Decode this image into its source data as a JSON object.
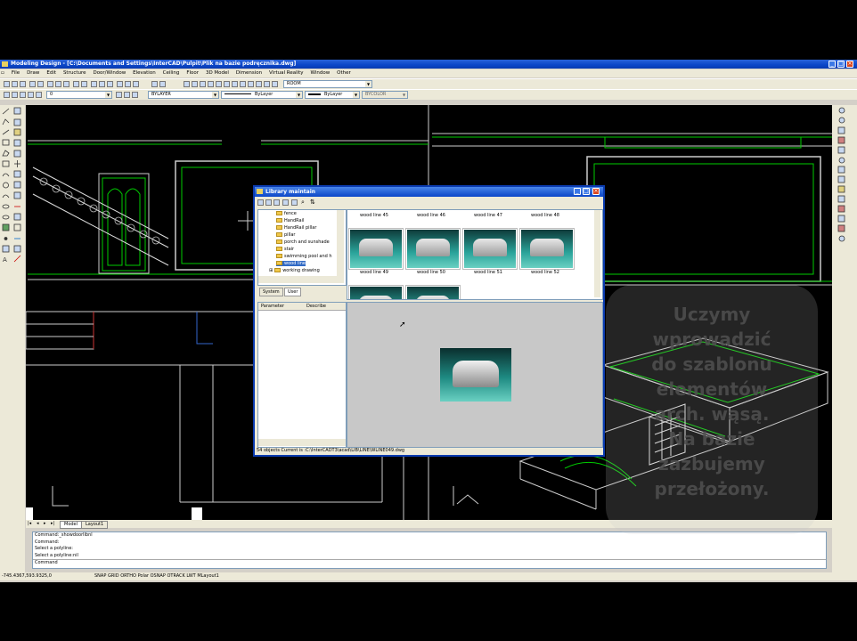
{
  "app": {
    "title": "Modeling Design - [C:\\Documents and Settings\\InterCAD\\Pulpit\\Plik na bazie podręcznika.dwg]",
    "menu": [
      "File",
      "Draw",
      "Edit",
      "Structure",
      "Door/Window",
      "Elevation",
      "Ceiling",
      "Floor",
      "3D Model",
      "Dimension",
      "Virtual Reality",
      "Window",
      "Other"
    ]
  },
  "toolbar": {
    "layer_combo": "0",
    "color_combo": "BYLAYER",
    "linetype_combo": "ByLayer",
    "lineweight_combo": "ByLayer",
    "plotstyle_combo": "BYCOLOR",
    "room_combo": "ROOM"
  },
  "tabs": [
    "Model",
    "Layout1"
  ],
  "command": {
    "lines": [
      "Command:_showdoorlibnl",
      "Command:",
      "Select a polyline:",
      "Select a polyline:nil"
    ],
    "prompt": "Command"
  },
  "status": {
    "coords": "-745.4367,593.9325,0",
    "modes": "SNAP GRID ORTHO Polar OSNAP OTRACK LWT MLayout1"
  },
  "dialog": {
    "title": "Library maintain",
    "tree_items": [
      "fence",
      "HandRail",
      "HandRail pillar",
      "pillar",
      "porch and sunshade",
      "stair",
      "swimming pool and h",
      "wood line",
      "working drawing"
    ],
    "tabs": [
      "System",
      "User"
    ],
    "thumb_top_labels": [
      "wood line 45",
      "wood line 46",
      "wood line 47",
      "wood line 48"
    ],
    "thumb_labels": [
      "wood line 49",
      "wood line 50",
      "wood line 51",
      "wood line 52"
    ],
    "param_headers": [
      "Parameter",
      "Describe"
    ],
    "status": "54 objects  Current is :C:\\InterCADT3\\acad\\LIB\\LINE\\WLINE049.dwg"
  },
  "watermark": {
    "lines": [
      "Uczymy",
      "wprowadzić",
      "do szablonu",
      "elementów",
      "arch. wąsą.",
      "Na bazie",
      "zazbujemy",
      "przełożony."
    ]
  }
}
